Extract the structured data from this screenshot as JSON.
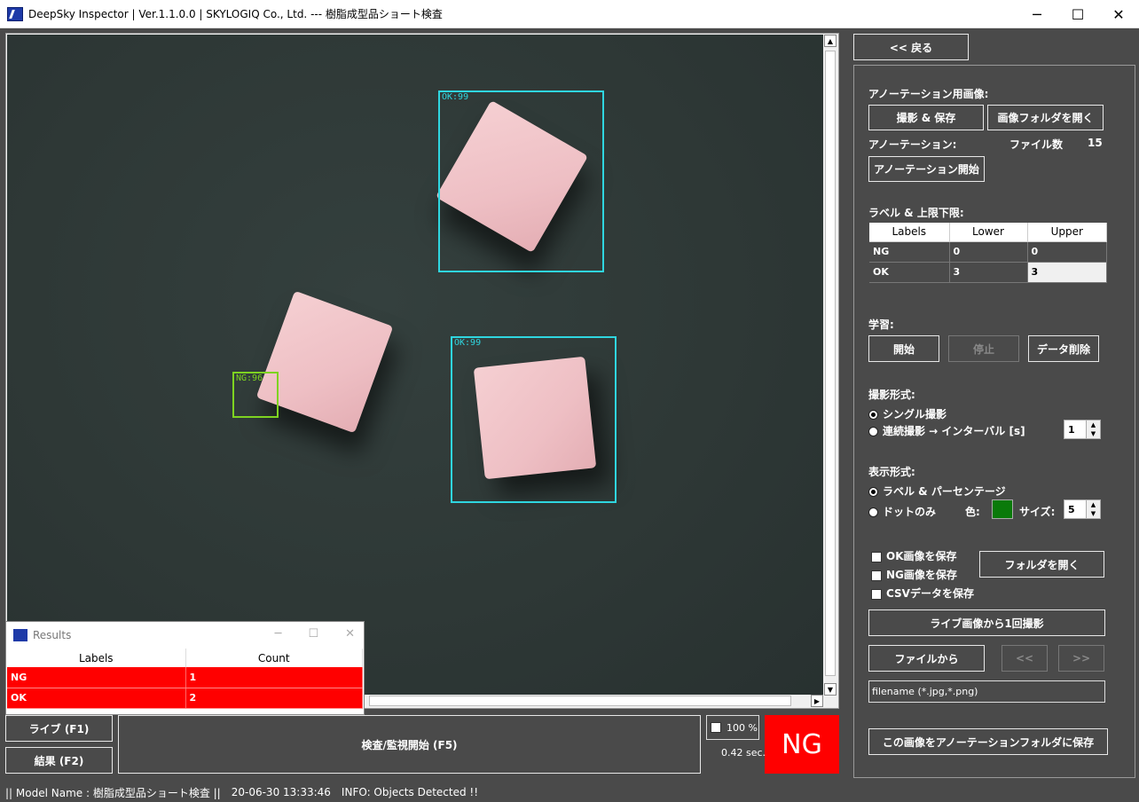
{
  "window": {
    "title": "DeepSky Inspector | Ver.1.1.0.0 | SKYLOGIQ Co., Ltd. --- 樹脂成型品ショート検査",
    "minimize": "─",
    "maximize": "☐",
    "close": "✕"
  },
  "detections": [
    {
      "label": "OK:99",
      "status": "ok"
    },
    {
      "label": "OK:99",
      "status": "ok"
    },
    {
      "label": "NG:96",
      "status": "ng"
    }
  ],
  "results": {
    "title": "Results",
    "headers": [
      "Labels",
      "Count"
    ],
    "rows": [
      {
        "label": "NG",
        "count": "1"
      },
      {
        "label": "OK",
        "count": "2"
      }
    ]
  },
  "bottom": {
    "live_button": "ライブ (F1)",
    "result_button": "結果 (F2)",
    "inspect_button": "検査/監視開始 (F5)",
    "zoom": "100 %",
    "elapsed": "0.42 sec.",
    "verdict": "NG",
    "verdict_color": "#ff0000"
  },
  "status": {
    "model": "|| Model Name : 樹脂成型品ショート検査 ||",
    "timestamp": "20-06-30 13:33:46",
    "info": "INFO:   Objects Detected !!"
  },
  "panel": {
    "back_button": "<< 戻る",
    "annotation_image_label": "アノーテーション用画像:",
    "capture_save_button": "撮影 & 保存",
    "open_image_folder_button": "画像フォルダを開く",
    "annotation_label": "アノーテーション:",
    "file_count_label": "ファイル数",
    "file_count": "15",
    "annotation_start_button": "アノーテーション開始",
    "label_limits_label": "ラベル & 上限下限:",
    "limits_headers": [
      "Labels",
      "Lower",
      "Upper"
    ],
    "limits_rows": [
      {
        "label": "NG",
        "lower": "0",
        "upper": "0"
      },
      {
        "label": "OK",
        "lower": "3",
        "upper": "3"
      }
    ],
    "learning_label": "学習:",
    "start_button": "開始",
    "stop_button": "停止",
    "delete_data_button": "データ削除",
    "capture_mode_label": "撮影形式:",
    "single_capture": "シングル撮影",
    "continuous_capture": "連続撮影 → インターバル [s]",
    "interval_value": "1",
    "display_mode_label": "表示形式:",
    "label_percentage": "ラベル & パーセンテージ",
    "dots_only": "ドットのみ",
    "color_label": "色:",
    "size_label": "サイズ:",
    "size_value": "5",
    "dot_color": "#0a7a0a",
    "save_ok": "OK画像を保存",
    "save_ng": "NG画像を保存",
    "save_csv": "CSVデータを保存",
    "open_folder_button": "フォルダを開く",
    "live_capture_once_button": "ライブ画像から1回撮影",
    "from_file_button": "ファイルから",
    "prev_button": "<<",
    "next_button": ">>",
    "filename_placeholder": "filename (*.jpg,*.png)",
    "save_to_annotation_button": "この画像をアノーテーションフォルダに保存"
  }
}
